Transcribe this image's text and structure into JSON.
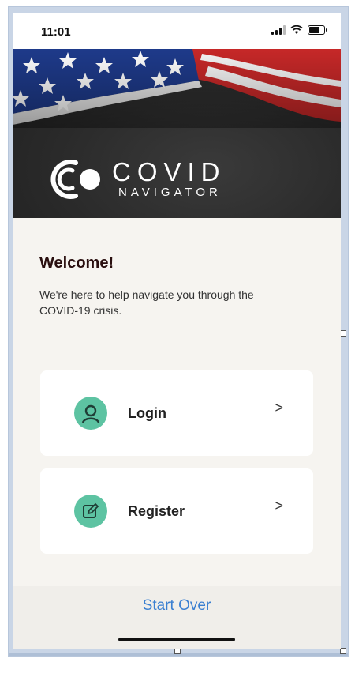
{
  "status_bar": {
    "time": "11:01",
    "icons": [
      "signal-icon",
      "wifi-icon",
      "battery-icon"
    ]
  },
  "hero": {
    "logo_title": "COVID",
    "logo_subtitle": "NAVIGATOR"
  },
  "main": {
    "welcome_title": "Welcome!",
    "intro_text": "We're here to help navigate you through the COVID-19 crisis."
  },
  "actions": {
    "login_label": "Login",
    "register_label": "Register",
    "chevron": ">"
  },
  "footer": {
    "start_over_label": "Start Over"
  },
  "colors": {
    "accent_green": "#5dc3a2",
    "link_blue": "#3a7fd1",
    "hero_dark": "#2a2a2a",
    "title_dark": "#2a0f0f"
  }
}
